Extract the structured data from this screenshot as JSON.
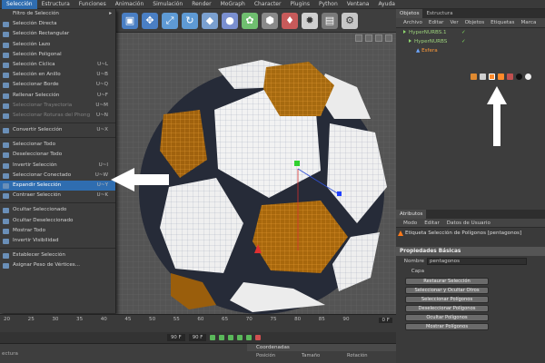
{
  "menubar": [
    "Selección",
    "Estructura",
    "Funciones",
    "Animación",
    "Simulación",
    "Render",
    "MoGraph",
    "Character",
    "Plugins",
    "Python",
    "Ventana",
    "Ayuda"
  ],
  "dropdown": {
    "items": [
      {
        "label": "Filtro de Selección",
        "shortcut": "",
        "submenu": true
      },
      {
        "label": "Selección Directa",
        "shortcut": ""
      },
      {
        "label": "Selección Rectangular",
        "shortcut": ""
      },
      {
        "label": "Selección Lazo",
        "shortcut": ""
      },
      {
        "label": "Selección Poligonal",
        "shortcut": ""
      },
      {
        "label": "Selección Cíclica",
        "shortcut": "U~L"
      },
      {
        "label": "Selección en Anillo",
        "shortcut": "U~B"
      },
      {
        "label": "Seleccionar Borde",
        "shortcut": "U~Q"
      },
      {
        "label": "Rellenar Selección",
        "shortcut": "U~F"
      },
      {
        "label": "Seleccionar Trayectoria",
        "shortcut": "U~M",
        "disabled": true
      },
      {
        "label": "Seleccionar Roturas del Phong",
        "shortcut": "U~N",
        "disabled": true
      },
      {
        "label": "Convertir Selección",
        "shortcut": "U~X",
        "sep_before": true
      },
      {
        "label": "Seleccionar Todo",
        "shortcut": "",
        "sep_before": true
      },
      {
        "label": "Deseleccionar Todo",
        "shortcut": ""
      },
      {
        "label": "Invertir Selección",
        "shortcut": "U~I"
      },
      {
        "label": "Seleccionar Conectado",
        "shortcut": "U~W"
      },
      {
        "label": "Expandir Selección",
        "shortcut": "U~Y",
        "highlighted": true
      },
      {
        "label": "Contraer Selección",
        "shortcut": "U~K"
      },
      {
        "label": "Ocultar Seleccionado",
        "shortcut": "",
        "sep_before": true
      },
      {
        "label": "Ocultar Deseleccionado",
        "shortcut": ""
      },
      {
        "label": "Mostrar Todo",
        "shortcut": ""
      },
      {
        "label": "Invertir Visibilidad",
        "shortcut": ""
      },
      {
        "label": "Establecer Selección",
        "shortcut": "",
        "sep_before": true
      },
      {
        "label": "Asignar Peso de Vértices...",
        "shortcut": ""
      }
    ]
  },
  "objects": {
    "tabs": [
      "Objetos",
      "Estructura"
    ],
    "menu": [
      "Archivo",
      "Editar",
      "Ver",
      "Objetos",
      "Etiquetas",
      "Marca"
    ],
    "tree": [
      {
        "label": "HyperNURBS.1"
      },
      {
        "label": "HyperNURBS"
      },
      {
        "label": "Esfera",
        "selected": true
      }
    ]
  },
  "attributes": {
    "tab": "Atributos",
    "menu": [
      "Modo",
      "Editar",
      "Datos de Usuario"
    ],
    "title": "Etiqueta Selección de Polígonos [pentagonos]",
    "section": "Propiedades Básicas",
    "fields": [
      {
        "label": "Nombre",
        "value": "pentagonos"
      },
      {
        "label": "Capa",
        "value": ""
      }
    ],
    "buttons": [
      "Restaurar Selección",
      "Seleccionar y Ocultar Otros",
      "Seleccionar Polígonos",
      "Deseleccionar Polígonos",
      "Ocultar Polígonos",
      "Mostrar Polígonos"
    ]
  },
  "timeline": {
    "ticks": [
      "20",
      "25",
      "30",
      "35",
      "40",
      "45",
      "50",
      "55",
      "60",
      "65",
      "70",
      "75",
      "80",
      "85",
      "90"
    ],
    "frame_fields": [
      "90 F",
      "90 F"
    ],
    "current_frame": "0 F"
  },
  "bottom": {
    "left_label": "ectura",
    "coord_title": "Coordenadas",
    "coord_cols": [
      "Posición",
      "Tamaño",
      "Rotación"
    ]
  }
}
